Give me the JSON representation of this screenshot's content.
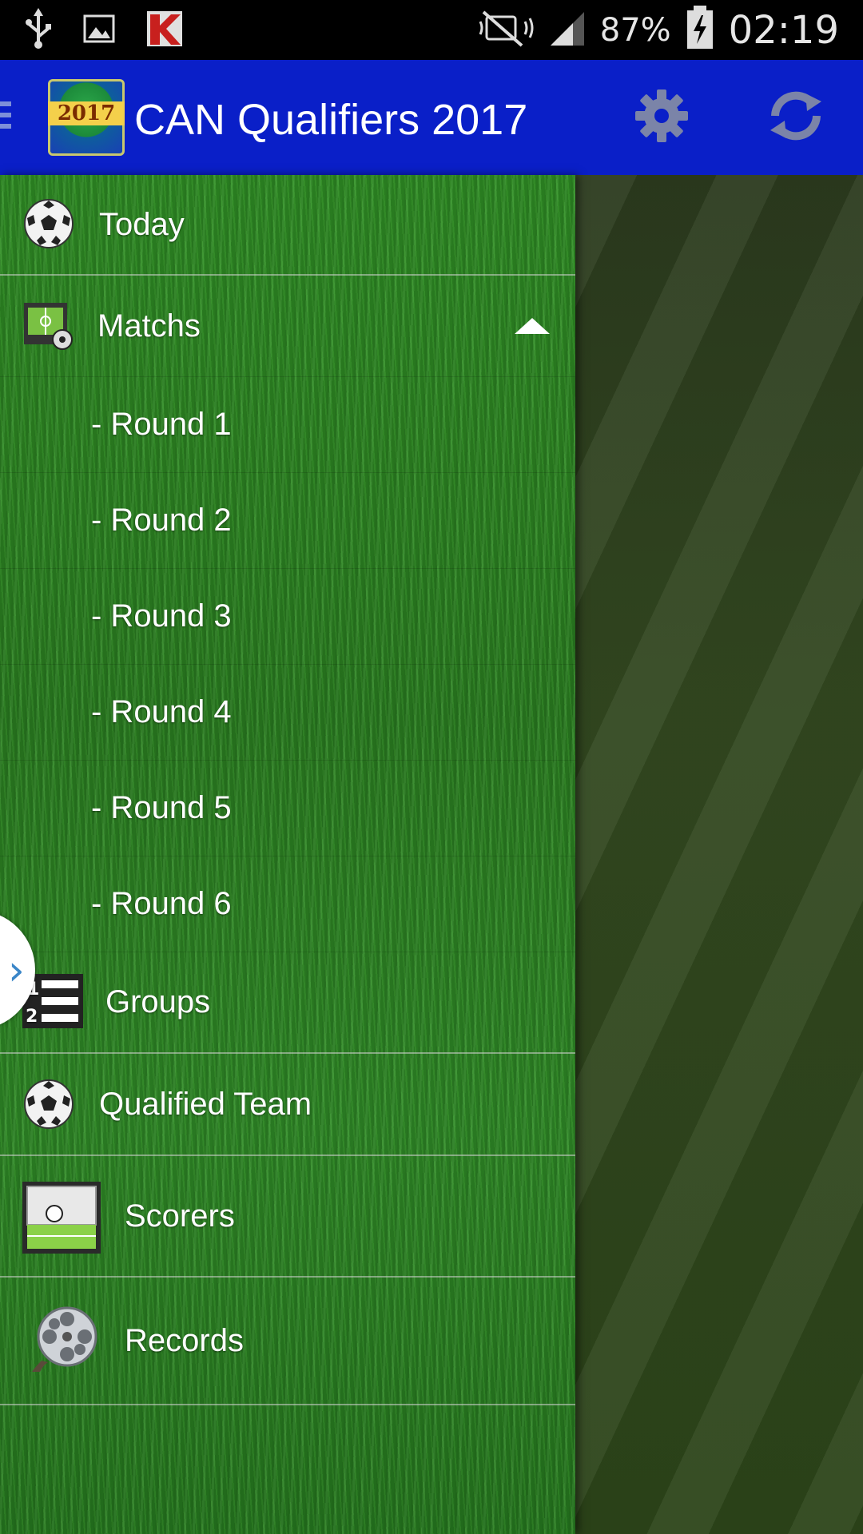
{
  "status_bar": {
    "battery": "87%",
    "time": "02:19",
    "icons": [
      "usb-icon",
      "image-icon",
      "kaspersky-icon",
      "mute-icon",
      "signal-icon",
      "battery-charging-icon"
    ]
  },
  "action_bar": {
    "title": "CAN Qualifiers 2017",
    "logo_text": "2017",
    "color": "#0a1fc8",
    "icons": [
      "menu-icon",
      "settings-icon",
      "refresh-icon"
    ]
  },
  "drawer": {
    "items": [
      {
        "label": "Today",
        "icon": "soccer-ball-icon"
      },
      {
        "label": "Matchs",
        "icon": "pitch-board-icon",
        "expanded": true
      },
      {
        "label": "- Round 1"
      },
      {
        "label": "- Round 2"
      },
      {
        "label": "- Round 3"
      },
      {
        "label": "- Round 4"
      },
      {
        "label": "- Round 5"
      },
      {
        "label": "- Round 6"
      },
      {
        "label": "Groups",
        "icon": "ranking-list-icon"
      },
      {
        "label": "Qualified Team",
        "icon": "soccer-ball-icon"
      },
      {
        "label": "Scorers",
        "icon": "goal-icon"
      },
      {
        "label": "Records",
        "icon": "film-reel-icon"
      }
    ]
  }
}
